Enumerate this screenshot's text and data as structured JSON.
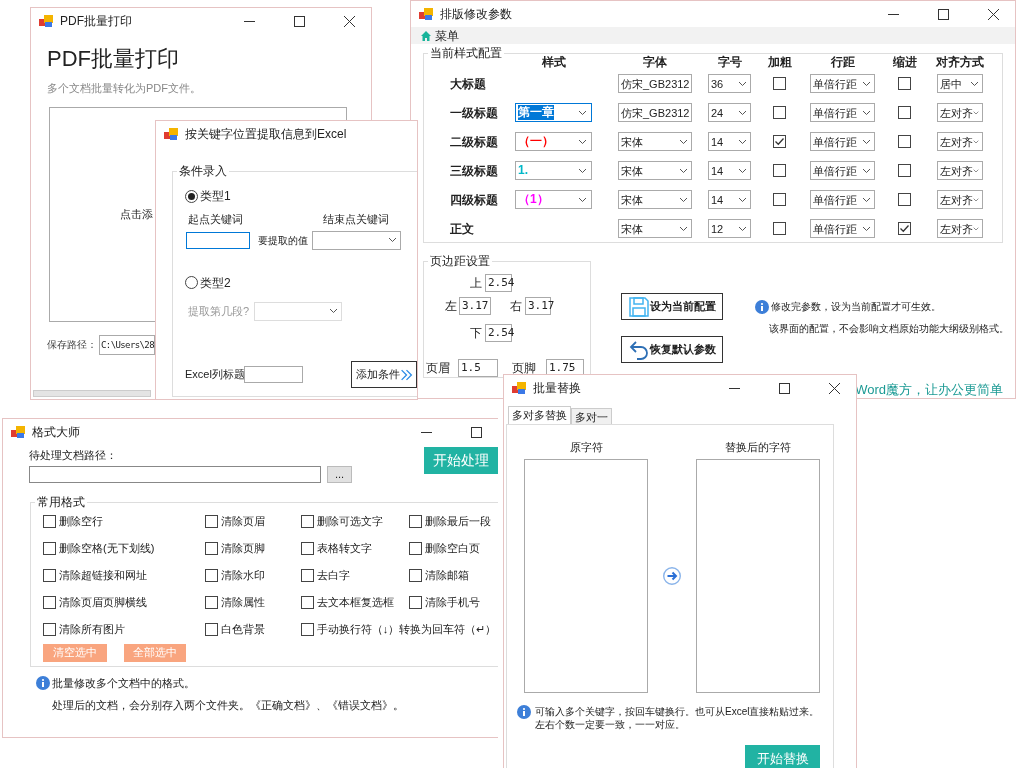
{
  "pdf_window": {
    "title": "PDF批量打印",
    "heading": "PDF批量打印",
    "subtitle": "多个文档批量转化为PDF文件。",
    "drop_hint": "点击添",
    "save_label": "保存路径：",
    "save_path": "C:\\Users\\28"
  },
  "typeset_window": {
    "title": "排版修改参数",
    "menu": "菜单",
    "style_group": "当前样式配置",
    "columns": [
      "样式",
      "字体",
      "字号",
      "加粗",
      "行距",
      "缩进",
      "对齐方式"
    ],
    "rows": [
      {
        "name": "大标题",
        "font": "仿宋_GB2312",
        "size": "36",
        "bold": false,
        "spacing": "单倍行距",
        "indent": false,
        "align": "居中"
      },
      {
        "name": "一级标题",
        "style": {
          "text": "第一章",
          "color": "#ffffff",
          "selected": true
        },
        "font": "仿宋_GB2312",
        "size": "24",
        "bold": false,
        "spacing": "单倍行距",
        "indent": false,
        "align": "左对齐"
      },
      {
        "name": "二级标题",
        "style": {
          "text": "（一）",
          "color": "#ff0000",
          "selected": false
        },
        "font": "宋体",
        "size": "14",
        "bold": true,
        "spacing": "单倍行距",
        "indent": false,
        "align": "左对齐"
      },
      {
        "name": "三级标题",
        "style": {
          "text": "1.",
          "color": "#00b8c8",
          "selected": false
        },
        "font": "宋体",
        "size": "14",
        "bold": false,
        "spacing": "单倍行距",
        "indent": false,
        "align": "左对齐"
      },
      {
        "name": "四级标题",
        "style": {
          "text": "（1）",
          "color": "#ff00ff",
          "selected": false
        },
        "font": "宋体",
        "size": "14",
        "bold": false,
        "spacing": "单倍行距",
        "indent": false,
        "align": "左对齐"
      },
      {
        "name": "正文",
        "font": "宋体",
        "size": "12",
        "bold": false,
        "spacing": "单倍行距",
        "indent": true,
        "align": "左对齐"
      }
    ],
    "margins": {
      "group": "页边距设置",
      "top": {
        "label": "上",
        "value": "2.54"
      },
      "left": {
        "label": "左",
        "value": "3.17"
      },
      "right": {
        "label": "右",
        "value": "3.17"
      },
      "bottom": {
        "label": "下",
        "value": "2.54"
      },
      "header": {
        "label": "页眉",
        "value": "1.5"
      },
      "footer": {
        "label": "页脚",
        "value": "1.75"
      }
    },
    "buttons": [
      {
        "kind": "save",
        "label": "设为当前配置"
      },
      {
        "kind": "undo",
        "label": "恢复默认参数"
      }
    ],
    "info": [
      "修改完参数，设为当前配置才可生效。",
      "该界面的配置，不会影响文档原始功能大纲级别格式。"
    ],
    "slogan": "Word魔方，让办公更简单"
  },
  "excel_dialog": {
    "title": "按关键字位置提取信息到Excel",
    "group": "条件录入",
    "types": [
      {
        "label": "类型1",
        "selected": true
      },
      {
        "label": "类型2",
        "selected": false
      }
    ],
    "start_label": "起点关键词",
    "end_label": "结束点关键词",
    "value_label": "要提取的值",
    "paragraph_field": {
      "label": "提取第几段?",
      "disabled": true
    },
    "column_label": "Excel列标题",
    "add_button": "添加条件"
  },
  "format_window": {
    "title": "格式大师",
    "path_label": "待处理文档路径：",
    "browse_button": "...",
    "start_button": "开始处理",
    "group": "常用格式",
    "option_columns": [
      [
        {
          "label": "删除空行",
          "checked": false
        },
        {
          "label": "删除空格(无下划线)",
          "checked": false
        },
        {
          "label": "清除超链接和网址",
          "checked": false
        },
        {
          "label": "清除页眉页脚横线",
          "checked": false
        },
        {
          "label": "清除所有图片",
          "checked": false
        }
      ],
      [
        {
          "label": "清除页眉",
          "checked": false
        },
        {
          "label": "清除页脚",
          "checked": false
        },
        {
          "label": "清除水印",
          "checked": false
        },
        {
          "label": "清除属性",
          "checked": false
        },
        {
          "label": "白色背景",
          "checked": false
        }
      ],
      [
        {
          "label": "删除可选文字",
          "checked": false
        },
        {
          "label": "表格转文字",
          "checked": false
        },
        {
          "label": "去白字",
          "checked": false
        },
        {
          "label": "去文本框复选框",
          "checked": false
        },
        {
          "label": "手动换行符（↓）转换为回车符（↵）",
          "checked": false
        }
      ],
      [
        {
          "label": "删除最后一段",
          "checked": false
        },
        {
          "label": "删除空白页",
          "checked": false
        },
        {
          "label": "清除邮箱",
          "checked": false
        },
        {
          "label": "清除手机号",
          "checked": false
        }
      ]
    ],
    "clear_button": "清空选中",
    "select_all_button": "全部选中",
    "info": [
      "批量修改多个文档中的格式。",
      "处理后的文档，会分别存入两个文件夹。《正确文档》、《错误文档》。"
    ]
  },
  "replace_window": {
    "title": "批量替换",
    "tabs": [
      {
        "label": "多对多替换",
        "selected": true
      },
      {
        "label": "多对一",
        "selected": false
      }
    ],
    "source_label": "原字符",
    "target_label": "替换后的字符",
    "info": [
      "可输入多个关键字，按回车键换行。也可从Excel直接粘贴过来。",
      "左右个数一定要一致，一一对应。"
    ],
    "start_button": "开始替换"
  }
}
